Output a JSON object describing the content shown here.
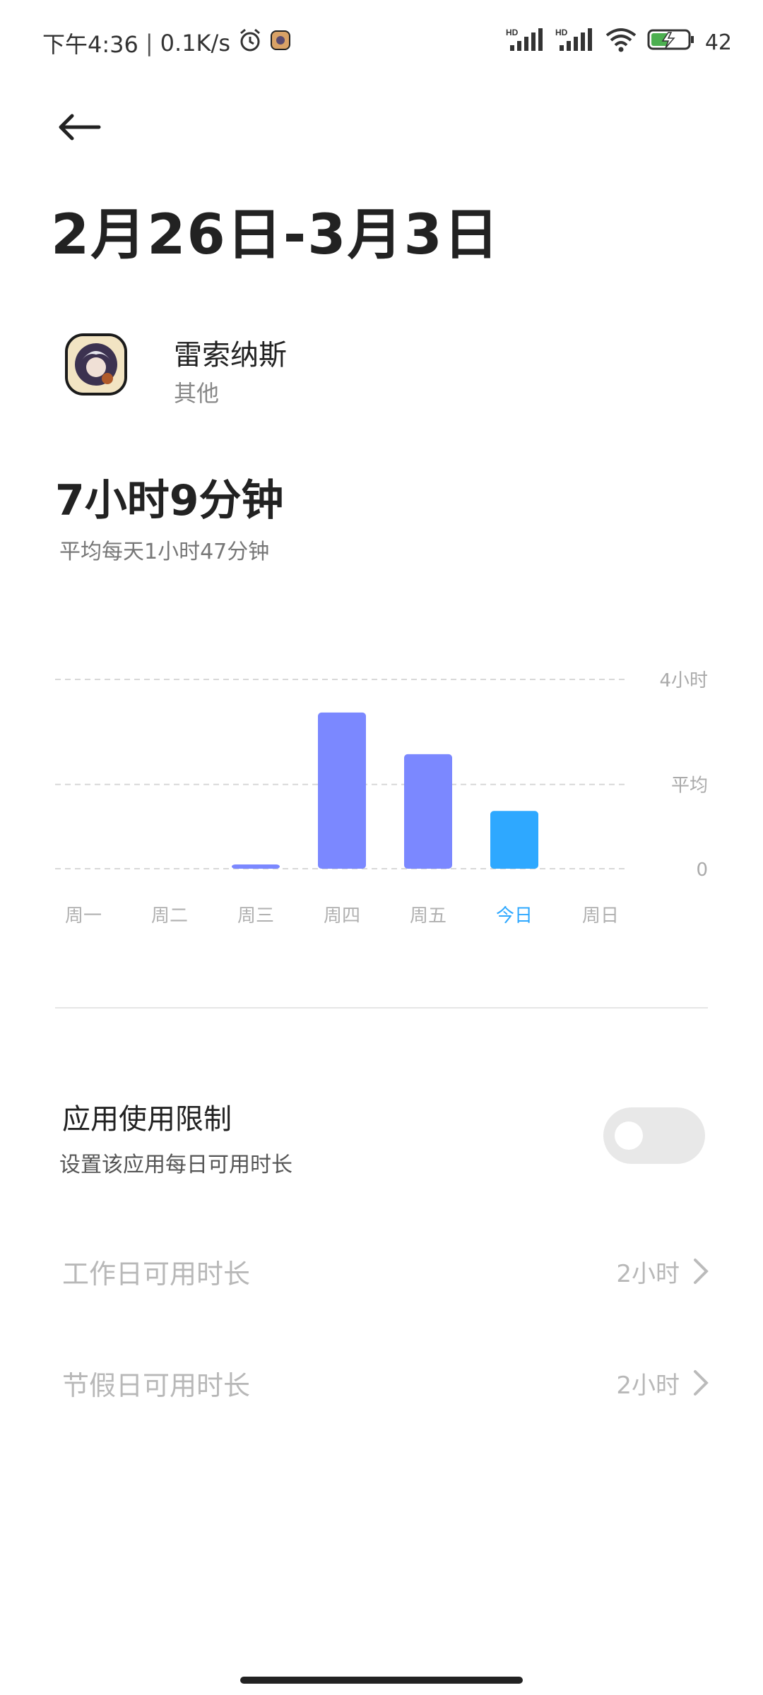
{
  "status_bar": {
    "time": "下午4:36",
    "net_speed": "0.1K/s",
    "battery_level": "42",
    "icons": [
      "alarm-icon",
      "app-notification-icon",
      "hd-signal-icon",
      "hd-signal-icon",
      "wifi-icon",
      "battery-charging-icon"
    ]
  },
  "header": {
    "date_range": "2月26日-3月3日"
  },
  "app": {
    "name": "雷索纳斯",
    "category": "其他"
  },
  "usage": {
    "total": "7小时9分钟",
    "average": "平均每天1小时47分钟"
  },
  "chart_data": {
    "type": "bar",
    "categories": [
      "周一",
      "周二",
      "周三",
      "周四",
      "周五",
      "今日",
      "周日"
    ],
    "values": [
      0,
      0,
      0.05,
      3.3,
      2.42,
      1.22,
      0
    ],
    "highlight_index": 5,
    "highlight_color": "#2ea8ff",
    "bar_color": "#7b88ff",
    "ylim": [
      0,
      4
    ],
    "y_ticks": [
      {
        "value": 4,
        "label": "4小时"
      },
      {
        "value": 1.78,
        "label": "平均"
      },
      {
        "value": 0,
        "label": "0"
      }
    ]
  },
  "limit": {
    "title": "应用使用限制",
    "subtitle": "设置该应用每日可用时长",
    "enabled": false
  },
  "rows": [
    {
      "label": "工作日可用时长",
      "value": "2小时"
    },
    {
      "label": "节假日可用时长",
      "value": "2小时"
    }
  ]
}
